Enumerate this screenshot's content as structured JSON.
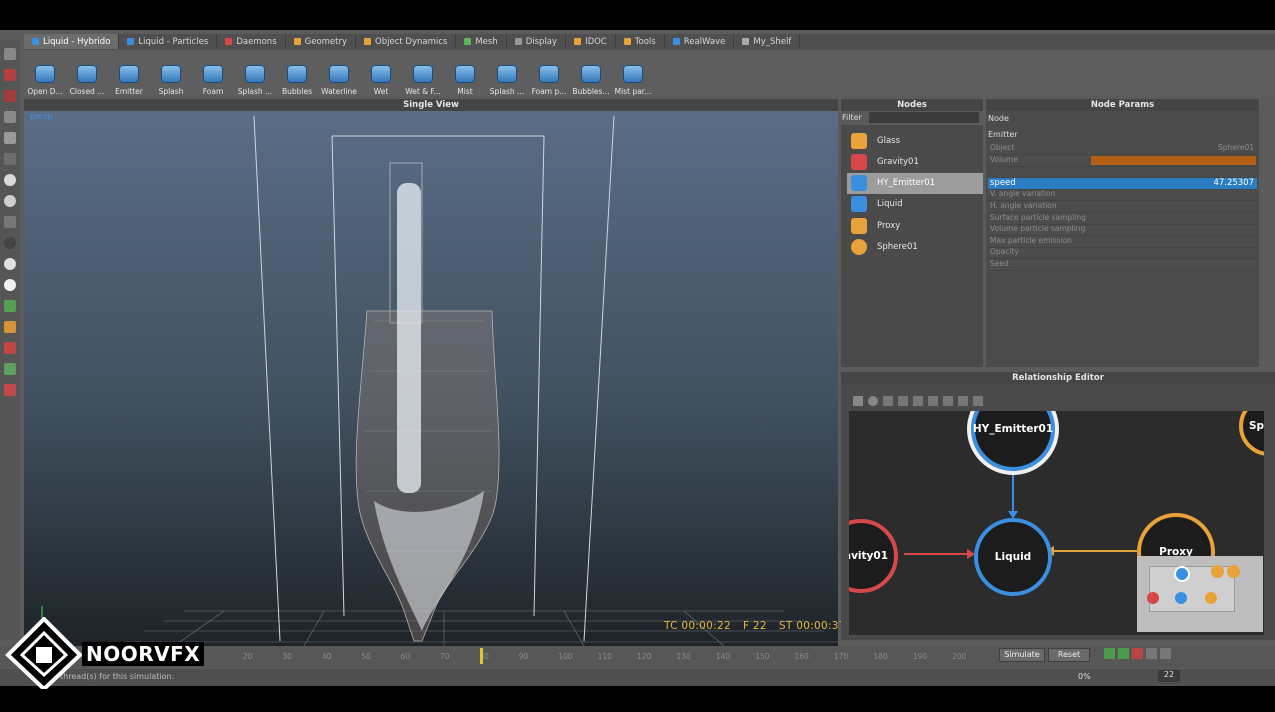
{
  "shelf_tabs": [
    {
      "label": "Liquid - Hybrido",
      "color": "#3a8fe0"
    },
    {
      "label": "Liquid - Particles",
      "color": "#3a8fe0"
    },
    {
      "label": "Daemons",
      "color": "#d94848"
    },
    {
      "label": "Geometry",
      "color": "#e8a23a"
    },
    {
      "label": "Object Dynamics",
      "color": "#e8a23a"
    },
    {
      "label": "Mesh",
      "color": "#5cb85c"
    },
    {
      "label": "Display",
      "color": "#999999"
    },
    {
      "label": "IDOC",
      "color": "#e8a23a"
    },
    {
      "label": "Tools",
      "color": "#e8a23a"
    },
    {
      "label": "RealWave",
      "color": "#3a8fe0"
    },
    {
      "label": "My_Shelf",
      "color": "#aaaaaa"
    }
  ],
  "shelf_tools": [
    "Open D...",
    "Closed ...",
    "Emitter",
    "Splash",
    "Foam",
    "Splash ...",
    "Bubbles",
    "Waterline",
    "Wet",
    "Wet & F...",
    "Mist",
    "Splash ...",
    "Foam p...",
    "Bubbles...",
    "Mist par..."
  ],
  "view": {
    "title": "Single View",
    "camera_label": "persp",
    "hud": {
      "tc": "TC 00:00:22",
      "frame": "F 22",
      "st": "ST 00:00:37"
    }
  },
  "nodes_panel": {
    "title": "Nodes",
    "filter_label": "Filter",
    "filter_value": "",
    "items": [
      {
        "label": "Glass",
        "icon": "cube-icon",
        "color": "#e8a23a"
      },
      {
        "label": "Gravity01",
        "icon": "gravity-icon",
        "color": "#d94848"
      },
      {
        "label": "HY_Emitter01",
        "icon": "emitter-icon",
        "color": "#3a8fe0"
      },
      {
        "label": "Liquid",
        "icon": "liquid-icon",
        "color": "#3a8fe0"
      },
      {
        "label": "Proxy",
        "icon": "cube-icon",
        "color": "#e8a23a"
      },
      {
        "label": "Sphere01",
        "icon": "sphere-icon",
        "color": "#e8a23a"
      }
    ],
    "selected": "HY_Emitter01"
  },
  "params_panel": {
    "title": "Node Params",
    "node_label": "Node",
    "section": "Emitter",
    "rows": [
      "Object",
      "Volume",
      "",
      "speed",
      "V. angle variation",
      "H. angle variation",
      "Surface particle sampling",
      "Volume particle sampling",
      "Max particle emission",
      "Opacity",
      "Seed"
    ],
    "object_value": "Sphere01",
    "speed_label": "speed",
    "speed_value": "47.25307",
    "speed_row_index": 3
  },
  "relationship_editor": {
    "title": "Relationship Editor",
    "graph_nodes": [
      {
        "label": "HY_Emitter01",
        "color": "#3a8fe0"
      },
      {
        "label": "Liquid",
        "color": "#3a8fe0"
      },
      {
        "label": "ravity01",
        "color": "#d94848"
      },
      {
        "label": "Proxy",
        "color": "#e8a23a"
      },
      {
        "label": "Spl",
        "color": "#e8a23a"
      }
    ]
  },
  "timeline": {
    "ticks": [
      "20",
      "30",
      "40",
      "50",
      "60",
      "70",
      "80",
      "90",
      "100",
      "110",
      "120",
      "130",
      "140",
      "150",
      "160",
      "170",
      "180",
      "190",
      "200"
    ],
    "current": "22",
    "end": "200"
  },
  "controls": {
    "simulate": "Simulate",
    "reset": "Reset",
    "percent": "0%"
  },
  "status": {
    "message": "thread(s) for this simulation."
  },
  "watermark": "NOORVFX"
}
